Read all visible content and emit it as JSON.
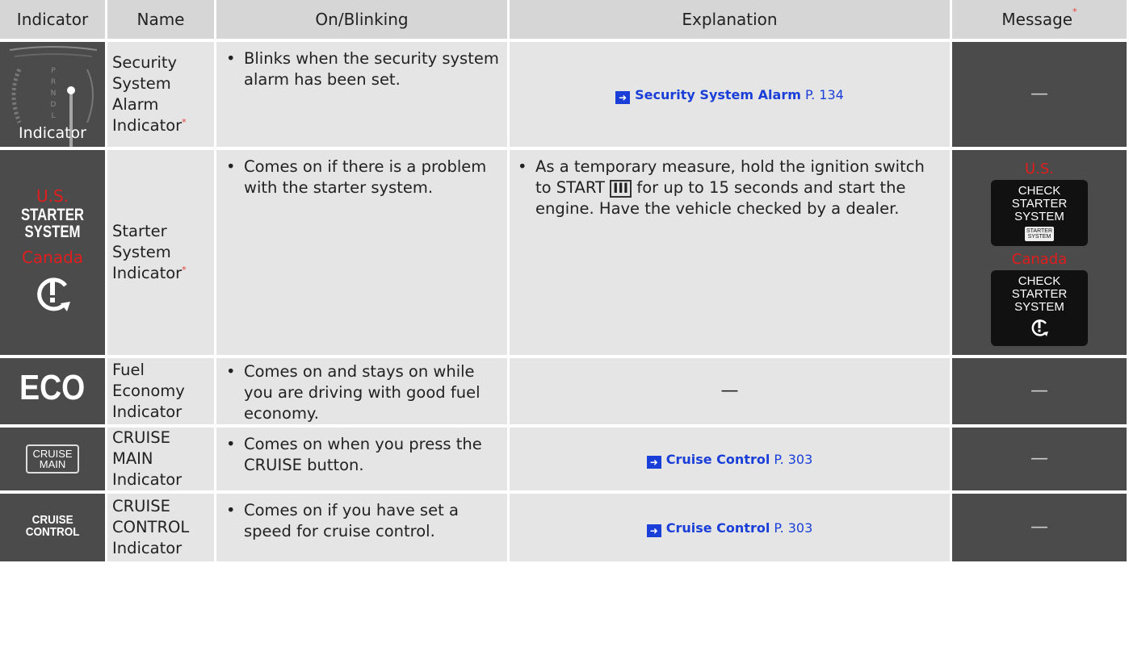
{
  "headers": {
    "indicator": "Indicator",
    "name": "Name",
    "on_blinking": "On/Blinking",
    "explanation": "Explanation",
    "message": "Message",
    "message_mark": "*"
  },
  "rows": [
    {
      "indicator_label": "Indicator",
      "gear_letters": [
        "P",
        "R",
        "N",
        "D",
        "L"
      ],
      "name": "Security System Alarm Indicator",
      "name_mark": "*",
      "on": "Blinks when the security system alarm has been set.",
      "link_title": "Security System Alarm",
      "link_page": "P. 134",
      "message": "—"
    },
    {
      "region_us": "U.S.",
      "us_text_1": "STARTER",
      "us_text_2": "SYSTEM",
      "region_ca": "Canada",
      "name": "Starter System Indicator",
      "name_mark": "*",
      "on": "Comes on if there is a problem with the starter system.",
      "expl_1": "As a temporary measure, hold the ignition switch to START",
      "expl_roman": "III",
      "expl_2": "for up to 15 seconds and start the engine. Have the vehicle checked by a dealer.",
      "msg_us_region": "U.S.",
      "msg_us_lines": [
        "CHECK",
        "STARTER",
        "SYSTEM"
      ],
      "msg_us_badge": [
        "STARTER",
        "SYSTEM"
      ],
      "msg_ca_region": "Canada",
      "msg_ca_lines": [
        "CHECK",
        "STARTER",
        "SYSTEM"
      ]
    },
    {
      "icon_text": "ECO",
      "name": "Fuel Economy Indicator",
      "on": "Comes on and stays on while you are driving with good fuel economy.",
      "explanation": "—",
      "message": "—"
    },
    {
      "icon_line_1": "CRUISE",
      "icon_line_2": "MAIN",
      "name": "CRUISE MAIN Indicator",
      "on": "Comes on when you press the CRUISE button.",
      "link_title": "Cruise Control",
      "link_page": "P. 303",
      "message": "—"
    },
    {
      "icon_line_1": "CRUISE",
      "icon_line_2": "CONTROL",
      "name": "CRUISE CONTROL Indicator",
      "on": "Comes on if you have set a speed for cruise control.",
      "link_title": "Cruise Control",
      "link_page": "P. 303",
      "message": "—"
    }
  ],
  "icons": {
    "bullet": "•",
    "link_arrow": "arrow-right-icon",
    "warning": "starter-warning-icon"
  },
  "colors": {
    "header_bg": "#d6d6d6",
    "cell_bg": "#e5e5e5",
    "icon_bg": "#4b4b4b",
    "link": "#1a3fd8",
    "region_red": "#e11d1d"
  }
}
